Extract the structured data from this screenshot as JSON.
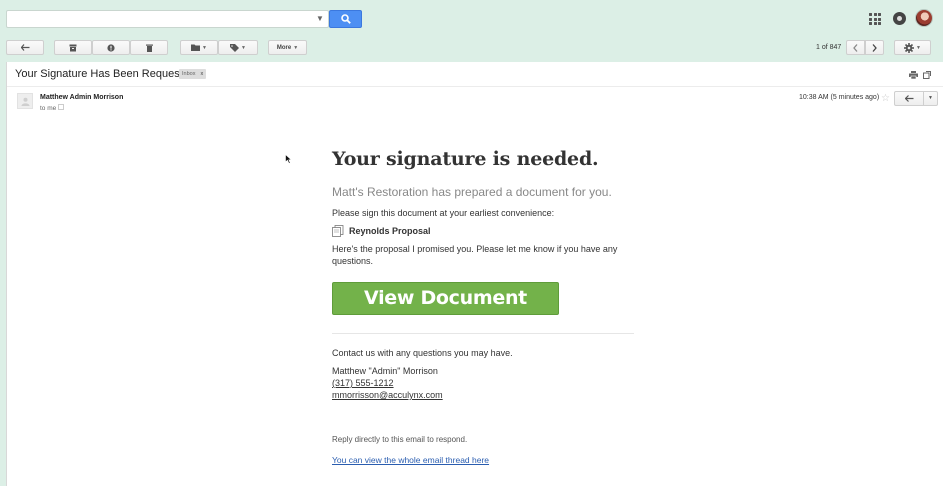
{
  "search": {
    "placeholder": ""
  },
  "toolbar": {
    "more_label": "More",
    "page_count": "1 of 847"
  },
  "email": {
    "subject": "Your Signature Has Been Requested",
    "label": "Inbox",
    "label_close": "x",
    "sender": "Matthew Admin Morrison",
    "recipient": "to me",
    "time": "10:38 AM (5 minutes ago)"
  },
  "body": {
    "headline": "Your signature is needed.",
    "subhead": "Matt's Restoration has prepared a document for you.",
    "please_sign": "Please sign this document at your earliest convenience:",
    "document_name": "Reynolds Proposal",
    "message": "Here's the proposal I promised you. Please let me know if you have any questions.",
    "button_label": "View Document",
    "contact_text": "Contact us with any questions you may have.",
    "signature_name": "Matthew \"Admin\" Morrison",
    "signature_phone": "(317) 555-1212",
    "signature_email": "mmorrisson@acculynx.com",
    "reply_note": "Reply directly to this email to respond.",
    "thread_link": "You can view the whole email thread here"
  },
  "colors": {
    "background": "#dcefe6",
    "search_button": "#4d8ff3",
    "cta_button": "#73b24a",
    "link": "#2a5db0"
  },
  "icons": {
    "search": "search-icon",
    "apps": "apps-grid-icon",
    "notifications": "notifications-icon",
    "back": "back-arrow-icon",
    "archive": "archive-icon",
    "spam": "report-spam-icon",
    "delete": "trash-icon",
    "move": "folder-icon",
    "labels": "label-icon",
    "prev": "chevron-left-icon",
    "next": "chevron-right-icon",
    "settings": "gear-icon",
    "print": "print-icon",
    "popout": "new-window-icon",
    "star": "star-icon",
    "reply": "reply-icon",
    "document": "document-icon"
  }
}
